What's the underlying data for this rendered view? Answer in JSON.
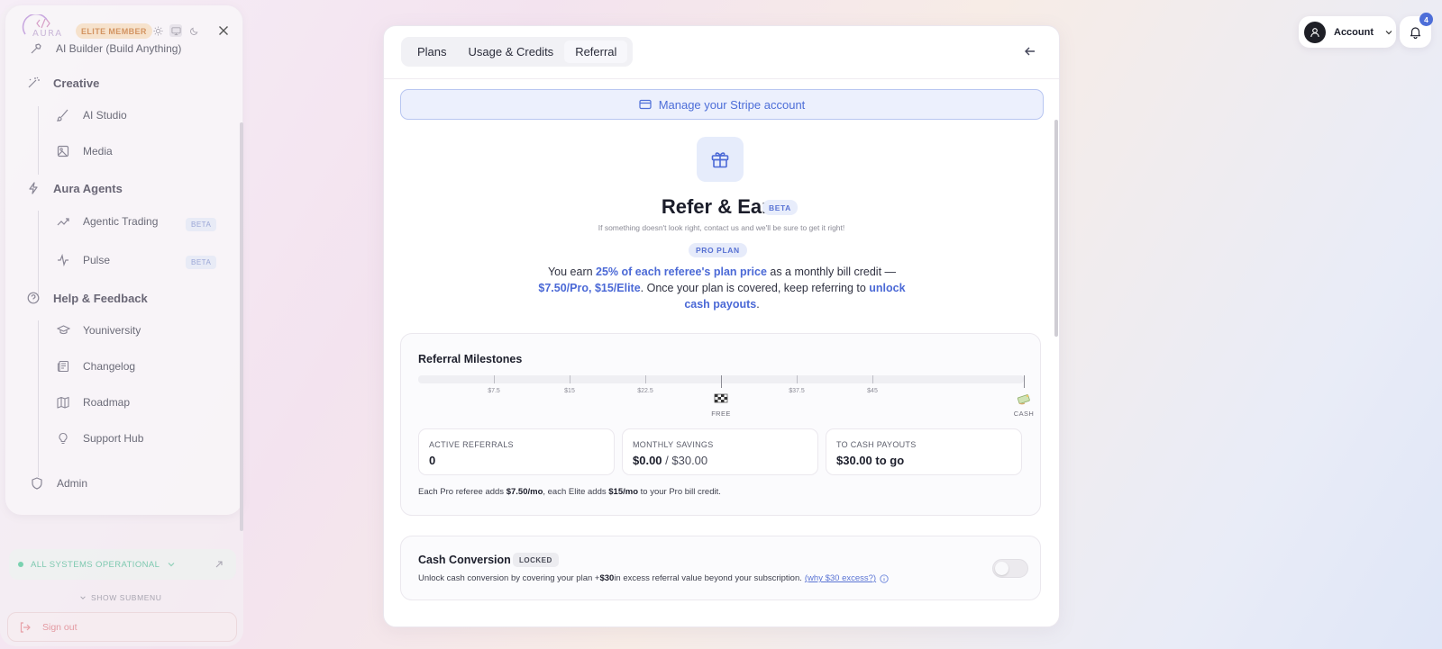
{
  "sidebar": {
    "logo_text": "AURA",
    "badge": "ELITE MEMBER",
    "items": [
      {
        "label": "AI Builder (Build Anything)",
        "icon": "hammer-icon"
      },
      {
        "label": "Creative",
        "icon": "wand-icon"
      },
      {
        "label": "AI Studio",
        "icon": "brush-icon"
      },
      {
        "label": "Media",
        "icon": "image-icon"
      },
      {
        "label": "Aura Agents",
        "icon": "bolt-icon"
      },
      {
        "label": "Agentic Trading",
        "icon": "trend-icon",
        "badge": "BETA"
      },
      {
        "label": "Pulse",
        "icon": "pulse-icon",
        "badge": "BETA"
      },
      {
        "label": "Help & Feedback",
        "icon": "help-icon"
      },
      {
        "label": "Youniversity",
        "icon": "graduation-icon"
      },
      {
        "label": "Changelog",
        "icon": "newspaper-icon"
      },
      {
        "label": "Roadmap",
        "icon": "map-icon"
      },
      {
        "label": "Support Hub",
        "icon": "lightbulb-icon"
      },
      {
        "label": "Admin",
        "icon": "shield-icon"
      }
    ],
    "status": "ALL SYSTEMS OPERATIONAL",
    "show_submenu": "SHOW SUBMENU",
    "sign_out": "Sign out"
  },
  "main": {
    "tabs": [
      {
        "label": "Plans"
      },
      {
        "label": "Usage & Credits"
      },
      {
        "label": "Referral"
      }
    ],
    "stripe_button": "Manage your Stripe account",
    "title": "Refer & Earn",
    "title_badge": "BETA",
    "subtitle": "If something doesn't look right, contact us and we'll be sure to get it right!",
    "plan_badge": "PRO PLAN",
    "earn": {
      "p1": "You earn ",
      "h1": "25% of each referee's plan price",
      "p2": " as a monthly bill credit — ",
      "h2": "$7.50/Pro, $15/Elite",
      "p3": ". Once your plan is covered, keep referring to ",
      "h3": "unlock cash payouts",
      "p4": "."
    },
    "milestones": {
      "title": "Referral Milestones",
      "ticks": [
        {
          "value": 7.5,
          "label": "$7.5"
        },
        {
          "value": 15,
          "label": "$15"
        },
        {
          "value": 22.5,
          "label": "$22.5"
        },
        {
          "value": 30,
          "label": "",
          "marker": "FREE"
        },
        {
          "value": 37.5,
          "label": "$37.5"
        },
        {
          "value": 45,
          "label": "$45"
        },
        {
          "value": 60,
          "label": "",
          "marker": "CASH"
        }
      ],
      "progress": 0,
      "stats": [
        {
          "label": "ACTIVE REFERRALS",
          "value": "0",
          "extra": ""
        },
        {
          "label": "MONTHLY SAVINGS",
          "value": "$0.00",
          "extra": " / $30.00"
        },
        {
          "label": "TO CASH PAYOUTS",
          "value": "$30.00 to go",
          "extra": ""
        }
      ],
      "note_p1": "Each Pro referee adds ",
      "note_b1": "$7.50/mo",
      "note_p2": ", each Elite adds ",
      "note_b2": "$15/mo",
      "note_p3": " to your Pro bill credit."
    },
    "cash_conversion": {
      "title": "Cash Conversion",
      "badge": "LOCKED",
      "desc_p1": "Unlock cash conversion by covering your plan + ",
      "desc_b": "$30",
      "desc_p2": " in excess referral value beyond your subscription.",
      "link": "(why $30 excess?)",
      "enabled": false
    }
  },
  "topbar": {
    "account": "Account",
    "notifications": "4"
  },
  "colors": {
    "accent": "#4d6ed8",
    "status_green": "#7ad2b0",
    "elite": "#d39462",
    "signout": "#e39aa2"
  }
}
